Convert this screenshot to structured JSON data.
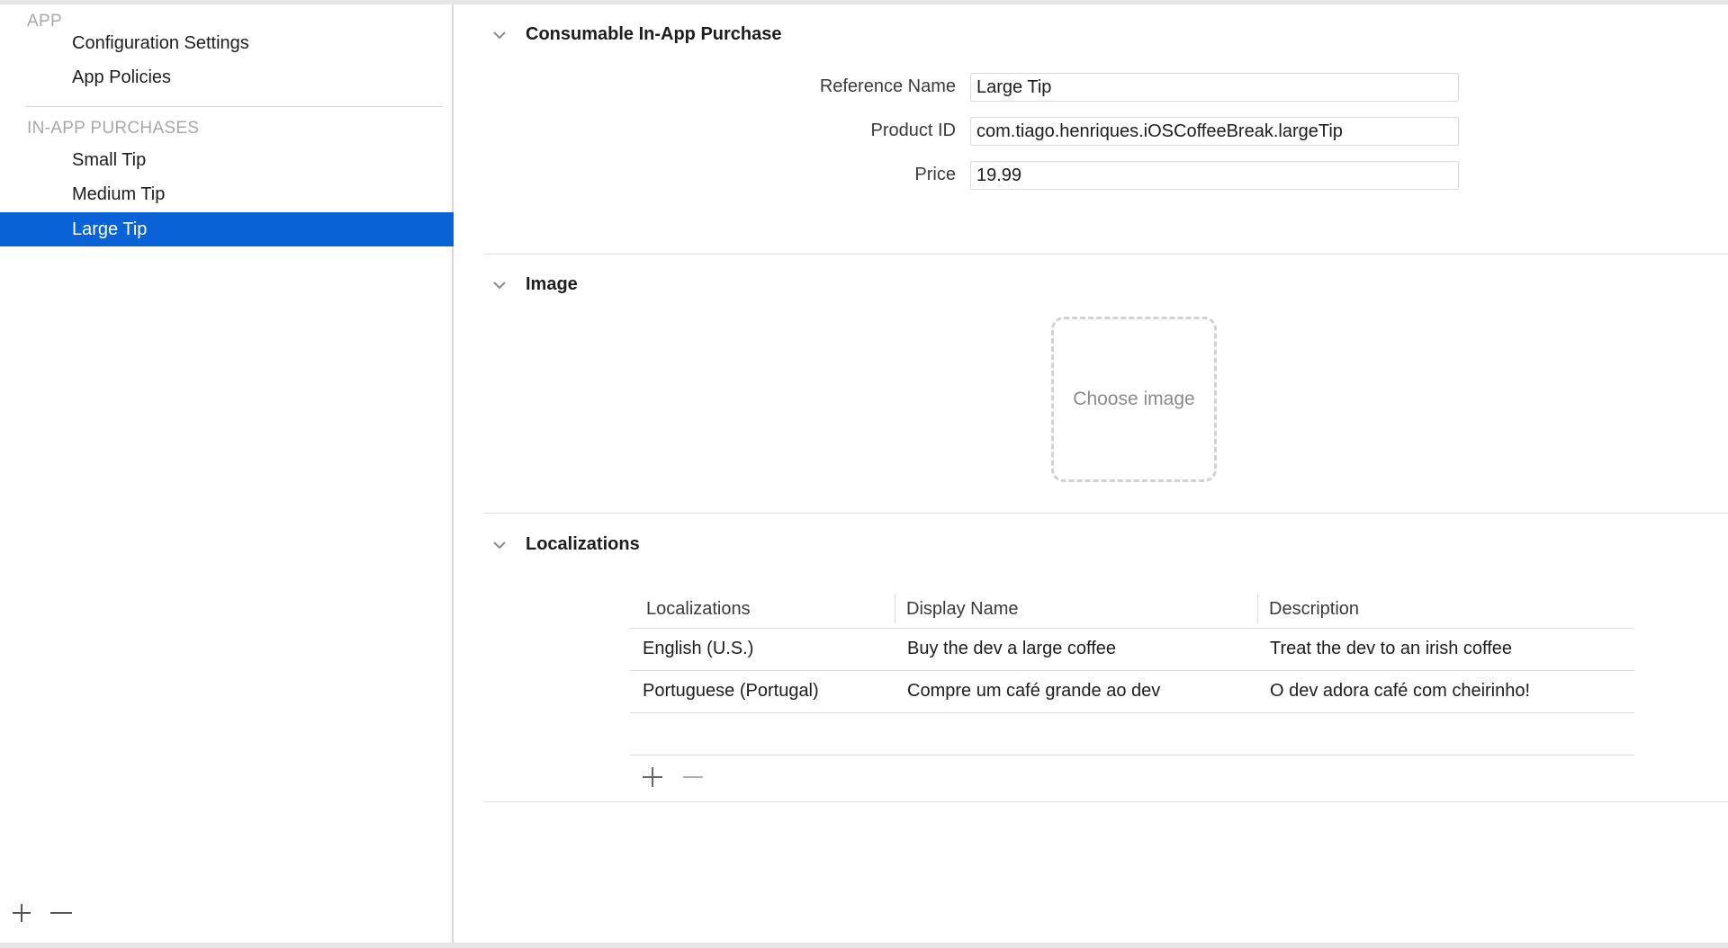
{
  "sidebar": {
    "app_header": "APP",
    "app_items": [
      {
        "label": "Configuration Settings"
      },
      {
        "label": "App Policies"
      }
    ],
    "iap_header": "IN-APP PURCHASES",
    "iap_items": [
      {
        "label": "Small Tip",
        "selected": false
      },
      {
        "label": "Medium Tip",
        "selected": false
      },
      {
        "label": "Large Tip",
        "selected": true
      }
    ],
    "footer_icons": [
      "plus-icon",
      "minus-icon"
    ]
  },
  "purchase": {
    "title": "Consumable In-App Purchase",
    "fields": [
      {
        "label": "Reference Name",
        "value": "Large Tip"
      },
      {
        "label": "Product ID",
        "value": "com.tiago.henriques.iOSCoffeeBreak.largeTip"
      },
      {
        "label": "Price",
        "value": "19.99"
      }
    ]
  },
  "image_section": {
    "title": "Image",
    "placeholder": "Choose image"
  },
  "localizations": {
    "title": "Localizations",
    "columns": [
      "Localizations",
      "Display Name",
      "Description"
    ],
    "rows": [
      {
        "locale": "English (U.S.)",
        "display_name": "Buy the dev a large coffee",
        "description": "Treat the dev to an irish coffee"
      },
      {
        "locale": "Portuguese (Portugal)",
        "display_name": "Compre um café grande ao dev",
        "description": "O dev adora café com cheirinho!"
      }
    ]
  },
  "colors": {
    "selection": "#0a63d6",
    "header_gray": "#a8a8a8"
  }
}
